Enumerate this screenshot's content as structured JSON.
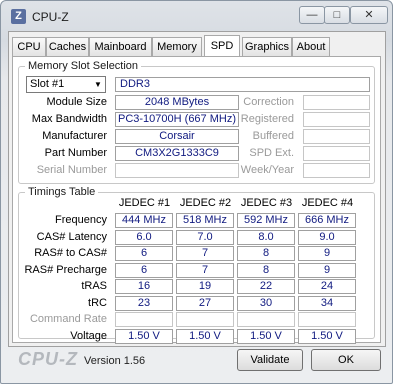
{
  "window": {
    "title": "CPU-Z",
    "icon_letter": "Z",
    "min": "—",
    "max": "□",
    "close": "✕"
  },
  "tabs": [
    "CPU",
    "Caches",
    "Mainboard",
    "Memory",
    "SPD",
    "Graphics",
    "About"
  ],
  "active_tab": "SPD",
  "memory_slot": {
    "group_label": "Memory Slot Selection",
    "slot_value": "Slot #1",
    "type": "DDR3",
    "labels": {
      "module_size": "Module Size",
      "max_bandwidth": "Max Bandwidth",
      "manufacturer": "Manufacturer",
      "part_number": "Part Number",
      "serial_number": "Serial Number",
      "correction": "Correction",
      "registered": "Registered",
      "buffered": "Buffered",
      "spd_ext": "SPD Ext.",
      "week_year": "Week/Year"
    },
    "values": {
      "module_size": "2048 MBytes",
      "max_bandwidth": "PC3-10700H (667 MHz)",
      "manufacturer": "Corsair",
      "part_number": "CM3X2G1333C9",
      "serial_number": "",
      "correction": "",
      "registered": "",
      "buffered": "",
      "spd_ext": "",
      "week_year": ""
    }
  },
  "timings": {
    "group_label": "Timings Table",
    "columns": [
      "JEDEC #1",
      "JEDEC #2",
      "JEDEC #3",
      "JEDEC #4"
    ],
    "rows": [
      {
        "label": "Frequency",
        "values": [
          "444 MHz",
          "518 MHz",
          "592 MHz",
          "666 MHz"
        ],
        "dim": false
      },
      {
        "label": "CAS# Latency",
        "values": [
          "6.0",
          "7.0",
          "8.0",
          "9.0"
        ],
        "dim": false
      },
      {
        "label": "RAS# to CAS#",
        "values": [
          "6",
          "7",
          "8",
          "9"
        ],
        "dim": false
      },
      {
        "label": "RAS# Precharge",
        "values": [
          "6",
          "7",
          "8",
          "9"
        ],
        "dim": false
      },
      {
        "label": "tRAS",
        "values": [
          "16",
          "19",
          "22",
          "24"
        ],
        "dim": false
      },
      {
        "label": "tRC",
        "values": [
          "23",
          "27",
          "30",
          "34"
        ],
        "dim": false
      },
      {
        "label": "Command Rate",
        "values": [
          "",
          "",
          "",
          ""
        ],
        "dim": true
      },
      {
        "label": "Voltage",
        "values": [
          "1.50 V",
          "1.50 V",
          "1.50 V",
          "1.50 V"
        ],
        "dim": false
      }
    ]
  },
  "footer": {
    "brand": "CPU-Z",
    "version": "Version 1.56",
    "validate": "Validate",
    "ok": "OK"
  }
}
